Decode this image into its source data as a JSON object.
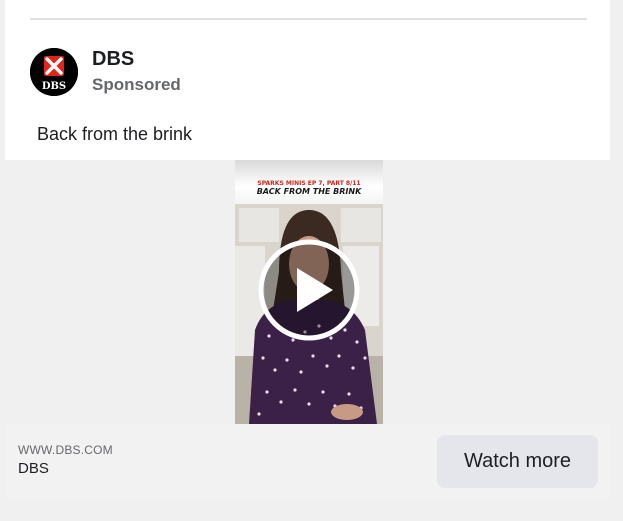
{
  "post": {
    "page_name": "DBS",
    "sponsored_label": "Sponsored",
    "text": "Back from the brink",
    "avatar_logo": "DBS",
    "avatar_icon": "dbs-logo-icon"
  },
  "video": {
    "banner_line1": "SPARKS MINIS EP 7, PART 8/11",
    "banner_line2": "BACK FROM THE BRINK",
    "play_icon": "play-icon"
  },
  "footer": {
    "domain": "WWW.DBS.COM",
    "title": "DBS",
    "cta_label": "Watch more"
  },
  "colors": {
    "brand_red": "#e1251b",
    "avatar_bg": "#000000",
    "button_bg": "#e4e6eb"
  }
}
